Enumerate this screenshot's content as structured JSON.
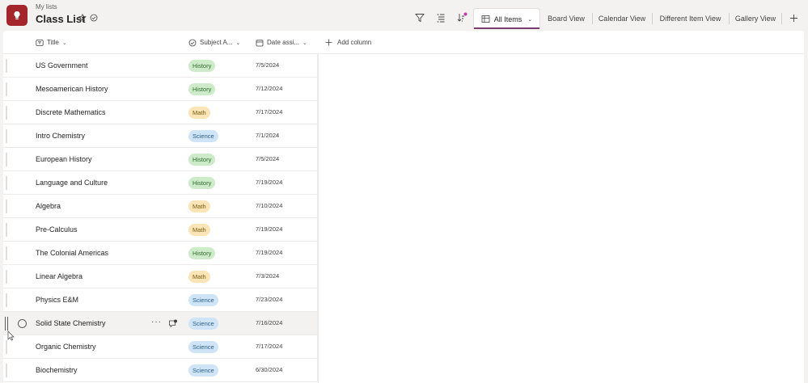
{
  "header": {
    "breadcrumb": "My lists",
    "title": "Class List"
  },
  "icons": {
    "app": "lightbulb-icon",
    "favorite": "star-icon",
    "sync": "check-circle-icon",
    "filter": "filter-icon",
    "group": "group-by-icon",
    "sort": "sort-icon",
    "add_view": "plus-icon"
  },
  "colors": {
    "app_icon": "#a4262c",
    "tab_accent": "#7a3b6e",
    "sort_dot": "#c239b3",
    "history_pill": "#cdebc9",
    "math_pill": "#fbe4b6",
    "science_pill": "#cfe4f7"
  },
  "views": {
    "active": "All Items",
    "tabs": [
      "Board View",
      "Calendar View",
      "Different Item View",
      "Gallery View"
    ]
  },
  "columns": {
    "title": "Title",
    "subject": "Subject A...",
    "date": "Date assi...",
    "add": "Add column"
  },
  "rows": [
    {
      "title": "US Government",
      "subject": "History",
      "date": "7/5/2024"
    },
    {
      "title": "Mesoamerican History",
      "subject": "History",
      "date": "7/12/2024"
    },
    {
      "title": "Discrete Mathematics",
      "subject": "Math",
      "date": "7/17/2024"
    },
    {
      "title": "Intro Chemistry",
      "subject": "Science",
      "date": "7/1/2024"
    },
    {
      "title": "European History",
      "subject": "History",
      "date": "7/5/2024"
    },
    {
      "title": "Language and Culture",
      "subject": "History",
      "date": "7/19/2024"
    },
    {
      "title": "Algebra",
      "subject": "Math",
      "date": "7/10/2024"
    },
    {
      "title": "Pre-Calculus",
      "subject": "Math",
      "date": "7/19/2024"
    },
    {
      "title": "The Colonial Americas",
      "subject": "History",
      "date": "7/19/2024"
    },
    {
      "title": "Linear Algebra",
      "subject": "Math",
      "date": "7/3/2024"
    },
    {
      "title": "Physics E&M",
      "subject": "Science",
      "date": "7/23/2024"
    },
    {
      "title": "Solid State Chemistry",
      "subject": "Science",
      "date": "7/16/2024"
    },
    {
      "title": "Organic Chemistry",
      "subject": "Science",
      "date": "7/17/2024"
    },
    {
      "title": "Biochemistry",
      "subject": "Science",
      "date": "6/30/2024"
    }
  ],
  "hover_row_actions": {
    "more": "···"
  }
}
